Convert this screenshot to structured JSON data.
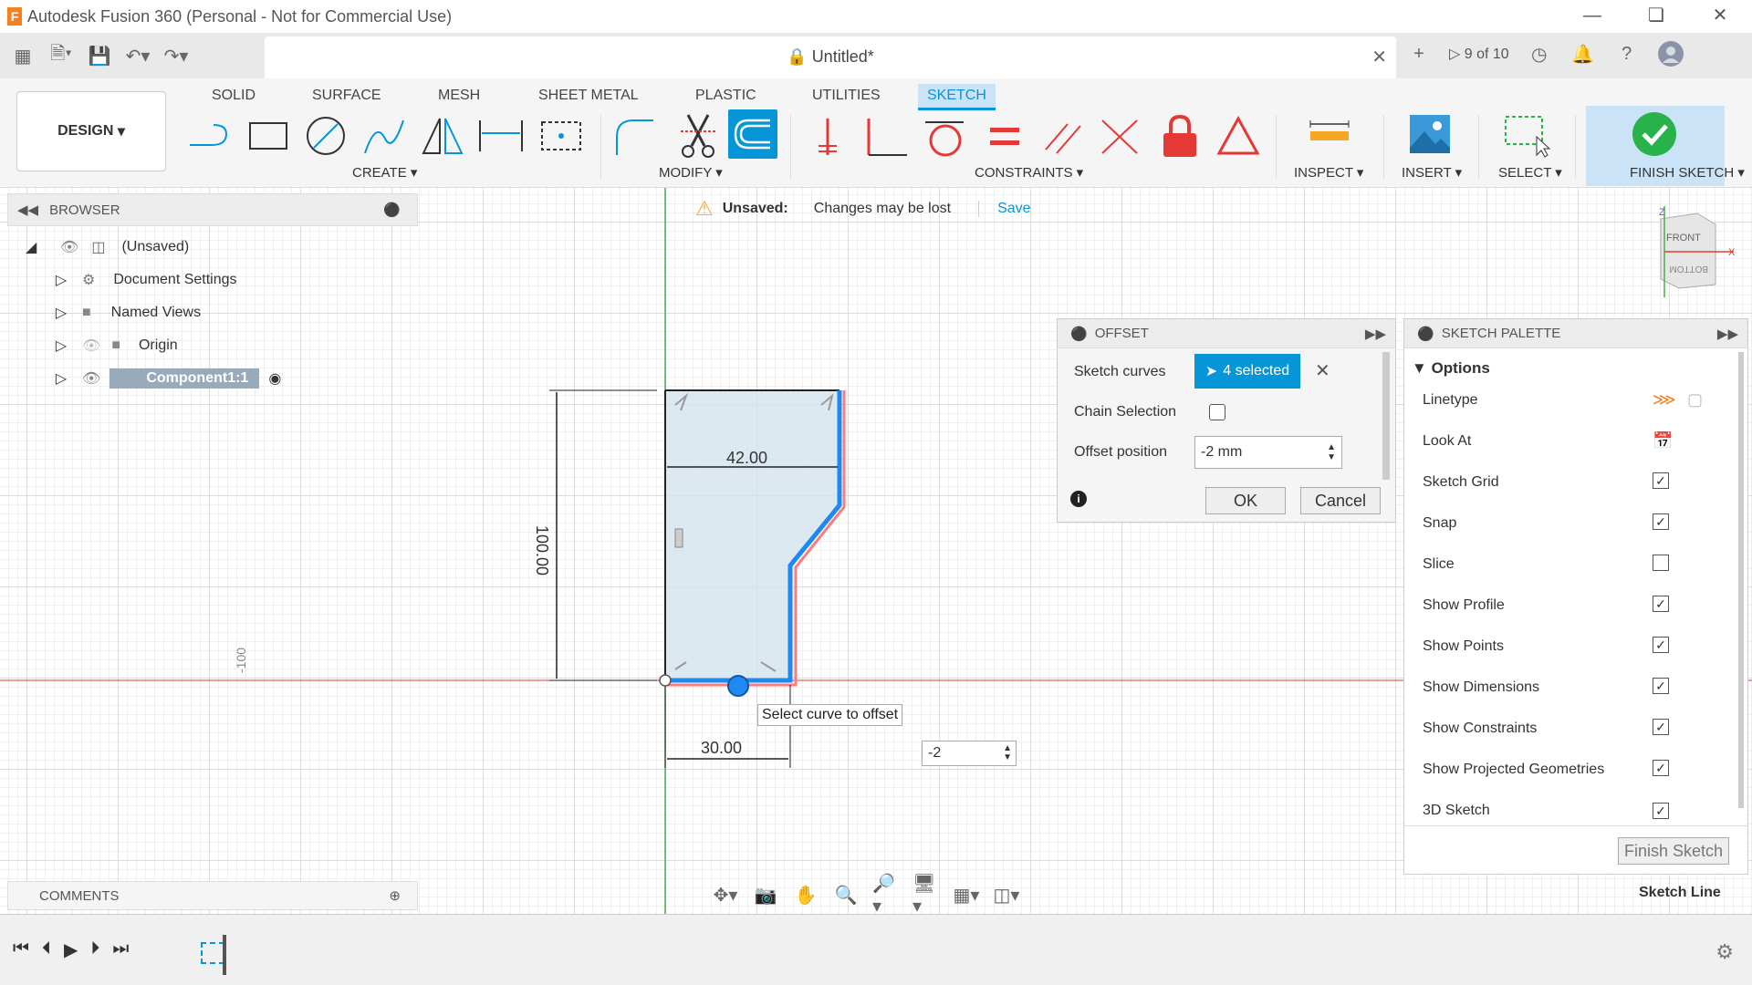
{
  "window": {
    "title": "Autodesk Fusion 360 (Personal - Not for Commercial Use)",
    "app_letter": "F"
  },
  "doc_tab": {
    "title": "Untitled*",
    "versions": "9 of 10"
  },
  "ribbon": {
    "tabs": [
      "SOLID",
      "SURFACE",
      "MESH",
      "SHEET METAL",
      "PLASTIC",
      "UTILITIES",
      "SKETCH"
    ],
    "active_tab": "SKETCH",
    "workspace": "DESIGN",
    "groups": {
      "create": "CREATE",
      "modify": "MODIFY",
      "constraints": "CONSTRAINTS",
      "inspect": "INSPECT",
      "insert": "INSERT",
      "select": "SELECT",
      "finish": "FINISH SKETCH"
    }
  },
  "browser": {
    "title": "BROWSER",
    "items": [
      {
        "label": "(Unsaved)"
      },
      {
        "label": "Document Settings"
      },
      {
        "label": "Named Views"
      },
      {
        "label": "Origin"
      },
      {
        "label": "Component1:1"
      }
    ]
  },
  "unsaved_bar": {
    "label": "Unsaved:",
    "message": "Changes may be lost",
    "save": "Save"
  },
  "offset": {
    "title": "OFFSET",
    "sketch_curves_label": "Sketch curves",
    "selected_text": "4 selected",
    "chain_selection_label": "Chain Selection",
    "chain_selection_checked": false,
    "offset_position_label": "Offset position",
    "offset_position_value": "-2 mm",
    "ok": "OK",
    "cancel": "Cancel"
  },
  "palette": {
    "title": "SKETCH PALETTE",
    "section": "Options",
    "rows": [
      {
        "label": "Linetype",
        "type": "icons"
      },
      {
        "label": "Look At",
        "type": "icon"
      },
      {
        "label": "Sketch Grid",
        "checked": true
      },
      {
        "label": "Snap",
        "checked": true
      },
      {
        "label": "Slice",
        "checked": false
      },
      {
        "label": "Show Profile",
        "checked": true
      },
      {
        "label": "Show Points",
        "checked": true
      },
      {
        "label": "Show Dimensions",
        "checked": true
      },
      {
        "label": "Show Constraints",
        "checked": true
      },
      {
        "label": "Show Projected Geometries",
        "checked": true
      },
      {
        "label": "3D Sketch",
        "checked": true
      }
    ],
    "finish_button": "Finish Sketch"
  },
  "canvas": {
    "dim_width_top": "42.00",
    "dim_height": "100.00",
    "dim_width_bottom": "30.00",
    "axis_label": "-100",
    "tooltip": "Select curve to offset",
    "inline_input": "-2",
    "status_text": "Sketch Line"
  },
  "viewcube": {
    "front": "FRONT",
    "bottom": "BOTTOM"
  },
  "comments": {
    "label": "COMMENTS"
  },
  "colors": {
    "accent": "#0696d7",
    "selection": "#1e88f5",
    "offset_preview": "#ff6b6b",
    "finish_green": "#27b24a"
  }
}
